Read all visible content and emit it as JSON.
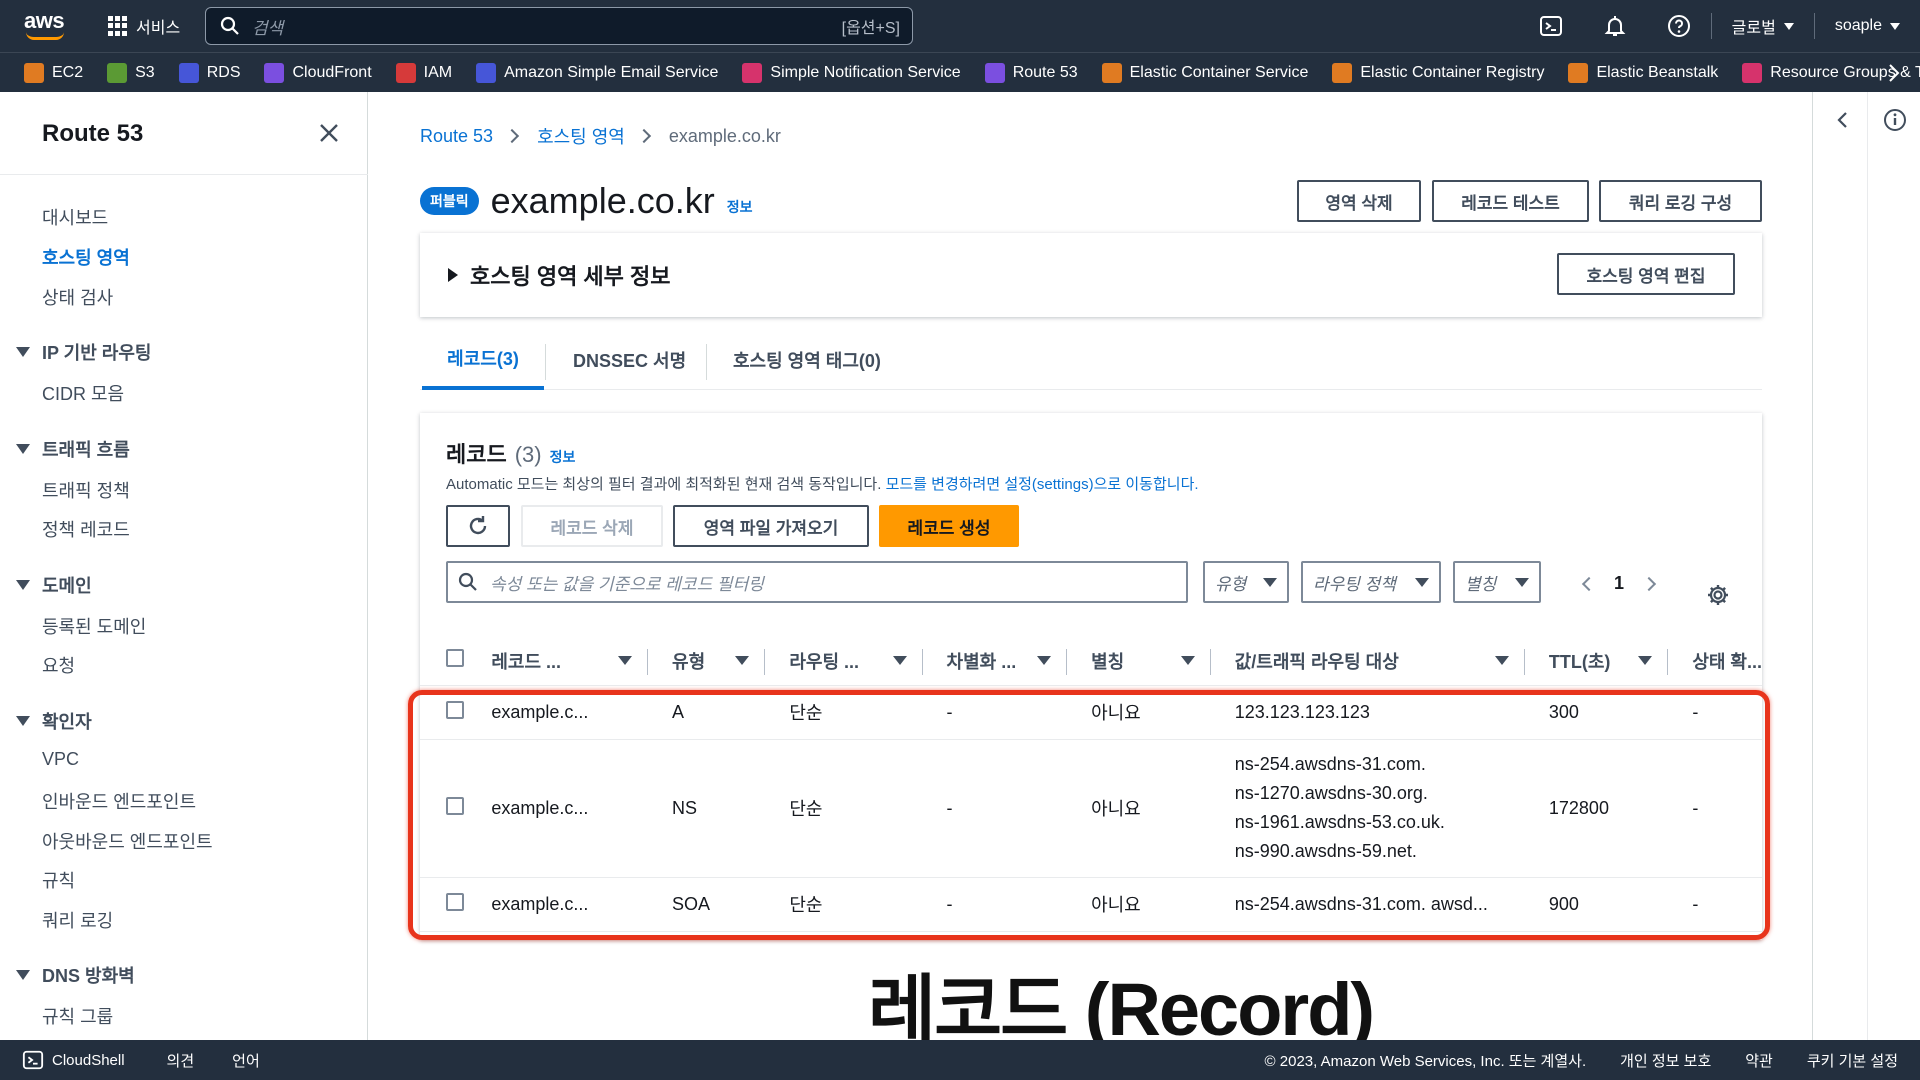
{
  "top": {
    "logo_text": "aws",
    "services_label": "서비스",
    "search_placeholder": "검색",
    "search_shortcut": "[옵션+S]",
    "region_label": "글로벌",
    "account_label": "soaple"
  },
  "favorites": [
    {
      "label": "EC2",
      "color": "#e07b22",
      "icon": "ec2-icon"
    },
    {
      "label": "S3",
      "color": "#5b9a34",
      "icon": "s3-icon"
    },
    {
      "label": "RDS",
      "color": "#4656d8",
      "icon": "rds-icon"
    },
    {
      "label": "CloudFront",
      "color": "#7b4fe0",
      "icon": "cloudfront-icon"
    },
    {
      "label": "IAM",
      "color": "#d63a3a",
      "icon": "iam-icon"
    },
    {
      "label": "Amazon Simple Email Service",
      "color": "#4656d8",
      "icon": "ses-icon"
    },
    {
      "label": "Simple Notification Service",
      "color": "#d6336c",
      "icon": "sns-icon"
    },
    {
      "label": "Route 53",
      "color": "#7b4fe0",
      "icon": "route53-icon"
    },
    {
      "label": "Elastic Container Service",
      "color": "#e07b22",
      "icon": "ecs-icon"
    },
    {
      "label": "Elastic Container Registry",
      "color": "#e07b22",
      "icon": "ecr-icon"
    },
    {
      "label": "Elastic Beanstalk",
      "color": "#e07b22",
      "icon": "beanstalk-icon"
    },
    {
      "label": "Resource Groups & T",
      "color": "#d6336c",
      "icon": "resource-groups-icon"
    }
  ],
  "sidebar": {
    "title": "Route 53",
    "top_items": [
      "대시보드",
      "호스팅 영역",
      "상태 검사"
    ],
    "active_item": "호스팅 영역",
    "sections": [
      {
        "label": "IP 기반 라우팅",
        "items": [
          "CIDR 모음"
        ]
      },
      {
        "label": "트래픽 흐름",
        "items": [
          "트래픽 정책",
          "정책 레코드"
        ]
      },
      {
        "label": "도메인",
        "items": [
          "등록된 도메인",
          "요청"
        ]
      },
      {
        "label": "확인자",
        "items": [
          "VPC",
          "인바운드 엔드포인트",
          "아웃바운드 엔드포인트",
          "규칙",
          "쿼리 로깅"
        ]
      },
      {
        "label": "DNS 방화벽",
        "items": [
          "규칙 그룹"
        ]
      }
    ]
  },
  "breadcrumb": [
    "Route 53",
    "호스팅 영역",
    "example.co.kr"
  ],
  "zone": {
    "badge": "퍼블릭",
    "name": "example.co.kr",
    "info": "정보",
    "btn_delete_zone": "영역 삭제",
    "btn_test_record": "레코드 테스트",
    "btn_query_logging": "쿼리 로깅 구성",
    "details_title": "호스팅 영역 세부 정보",
    "btn_edit_zone": "호스팅 영역 편집"
  },
  "tabs": [
    "레코드(3)",
    "DNSSEC 서명",
    "호스팅 영역 태그(0)"
  ],
  "records": {
    "title": "레코드",
    "count": "(3)",
    "info": "정보",
    "desc": "Automatic 모드는 최상의 필터 결과에 최적화된 현재 검색 동작입니다.",
    "desc_link": "모드를 변경하려면 설정(settings)으로 이동합니다.",
    "btn_delete": "레코드 삭제",
    "btn_import": "영역 파일 가져오기",
    "btn_create": "레코드 생성",
    "filter_placeholder": "속성 또는 값을 기준으로 레코드 필터링",
    "dd_type": "유형",
    "dd_routing": "라우팅 정책",
    "dd_alias": "별칭",
    "page": "1",
    "columns": [
      "레코드 ...",
      "유형",
      "라우팅 ...",
      "차별화 ...",
      "별칭",
      "값/트래픽 라우팅 대상",
      "TTL(초)",
      "상태 확..."
    ],
    "rows": [
      {
        "name": "example.c...",
        "type": "A",
        "routing": "단순",
        "diff": "-",
        "alias": "아니요",
        "values": [
          "123.123.123.123"
        ],
        "ttl": "300",
        "health": "-"
      },
      {
        "name": "example.c...",
        "type": "NS",
        "routing": "단순",
        "diff": "-",
        "alias": "아니요",
        "values": [
          "ns-254.awsdns-31.com.",
          "ns-1270.awsdns-30.org.",
          "ns-1961.awsdns-53.co.uk.",
          "ns-990.awsdns-59.net."
        ],
        "ttl": "172800",
        "health": "-"
      },
      {
        "name": "example.c...",
        "type": "SOA",
        "routing": "단순",
        "diff": "-",
        "alias": "아니요",
        "values": [
          "ns-254.awsdns-31.com. awsd..."
        ],
        "ttl": "900",
        "health": "-"
      }
    ]
  },
  "overlay_caption": "레코드 (Record)",
  "footer": {
    "cloudshell": "CloudShell",
    "feedback": "의견",
    "language": "언어",
    "copyright": "© 2023, Amazon Web Services, Inc. 또는 계열사.",
    "privacy": "개인 정보 보호",
    "terms": "약관",
    "cookies": "쿠키 기본 설정"
  },
  "colors": {
    "accent": "#0972d3",
    "primary_button": "#ff9900",
    "nav_bg": "#232f3e",
    "highlight": "#e8341c"
  }
}
